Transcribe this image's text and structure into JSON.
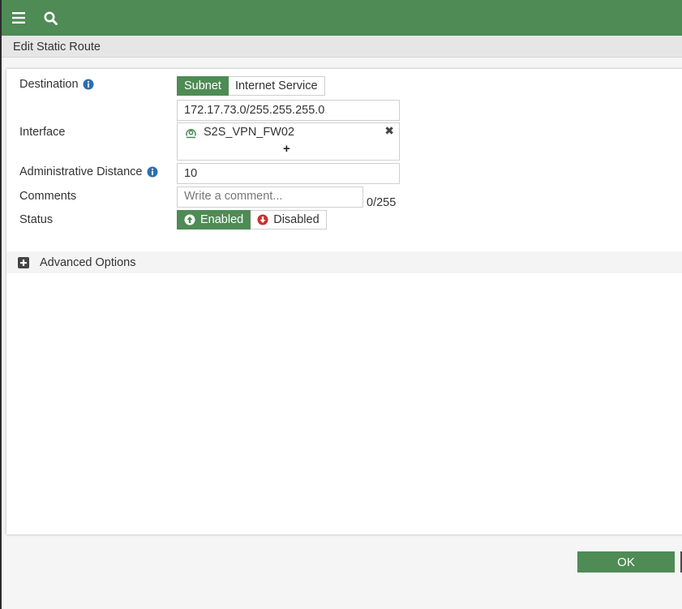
{
  "topbar": {
    "menu_icon": "hamburger-menu-icon",
    "search_icon": "search-icon",
    "color": "#4e8b55"
  },
  "dialog": {
    "title": "Edit Static Route"
  },
  "form": {
    "destination": {
      "label": "Destination",
      "options": [
        "Subnet",
        "Internet Service"
      ],
      "selected": "Subnet",
      "value": "172.17.73.0/255.255.255.0"
    },
    "interface": {
      "label": "Interface",
      "selected_item": "S2S_VPN_FW02",
      "add_symbol": "+",
      "remove_symbol": "✖"
    },
    "admin_distance": {
      "label": "Administrative Distance",
      "value": "10"
    },
    "comments": {
      "label": "Comments",
      "placeholder": "Write a comment...",
      "counter": "0/255"
    },
    "status": {
      "label": "Status",
      "enabled_label": "Enabled",
      "disabled_label": "Disabled",
      "selected": "Enabled"
    }
  },
  "advanced": {
    "label": "Advanced Options"
  },
  "footer": {
    "ok_label": "OK"
  }
}
